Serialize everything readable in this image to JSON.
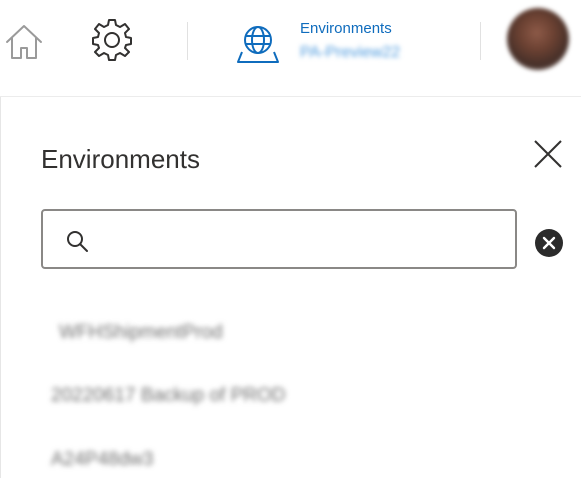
{
  "header": {
    "home_icon": "home-icon",
    "settings_icon": "gear-icon",
    "environment_icon": "globe-icon",
    "environment_heading": "Environments",
    "environment_current": "PA-Preview22",
    "avatar_icon": "user-avatar"
  },
  "panel": {
    "title": "Environments",
    "close_icon": "close-icon",
    "search": {
      "value": "",
      "placeholder": "",
      "icon": "search-icon"
    },
    "clear_icon": "clear-circle-icon",
    "environments": [
      {
        "name": "WFHShipmentProd"
      },
      {
        "name": "20220617 Backup of PROD"
      },
      {
        "name": "A24P48dw3"
      }
    ]
  },
  "colors": {
    "accent": "#0f6cbd",
    "text": "#323130",
    "border": "#8a8886",
    "clear_button": "#2b2b2b"
  }
}
